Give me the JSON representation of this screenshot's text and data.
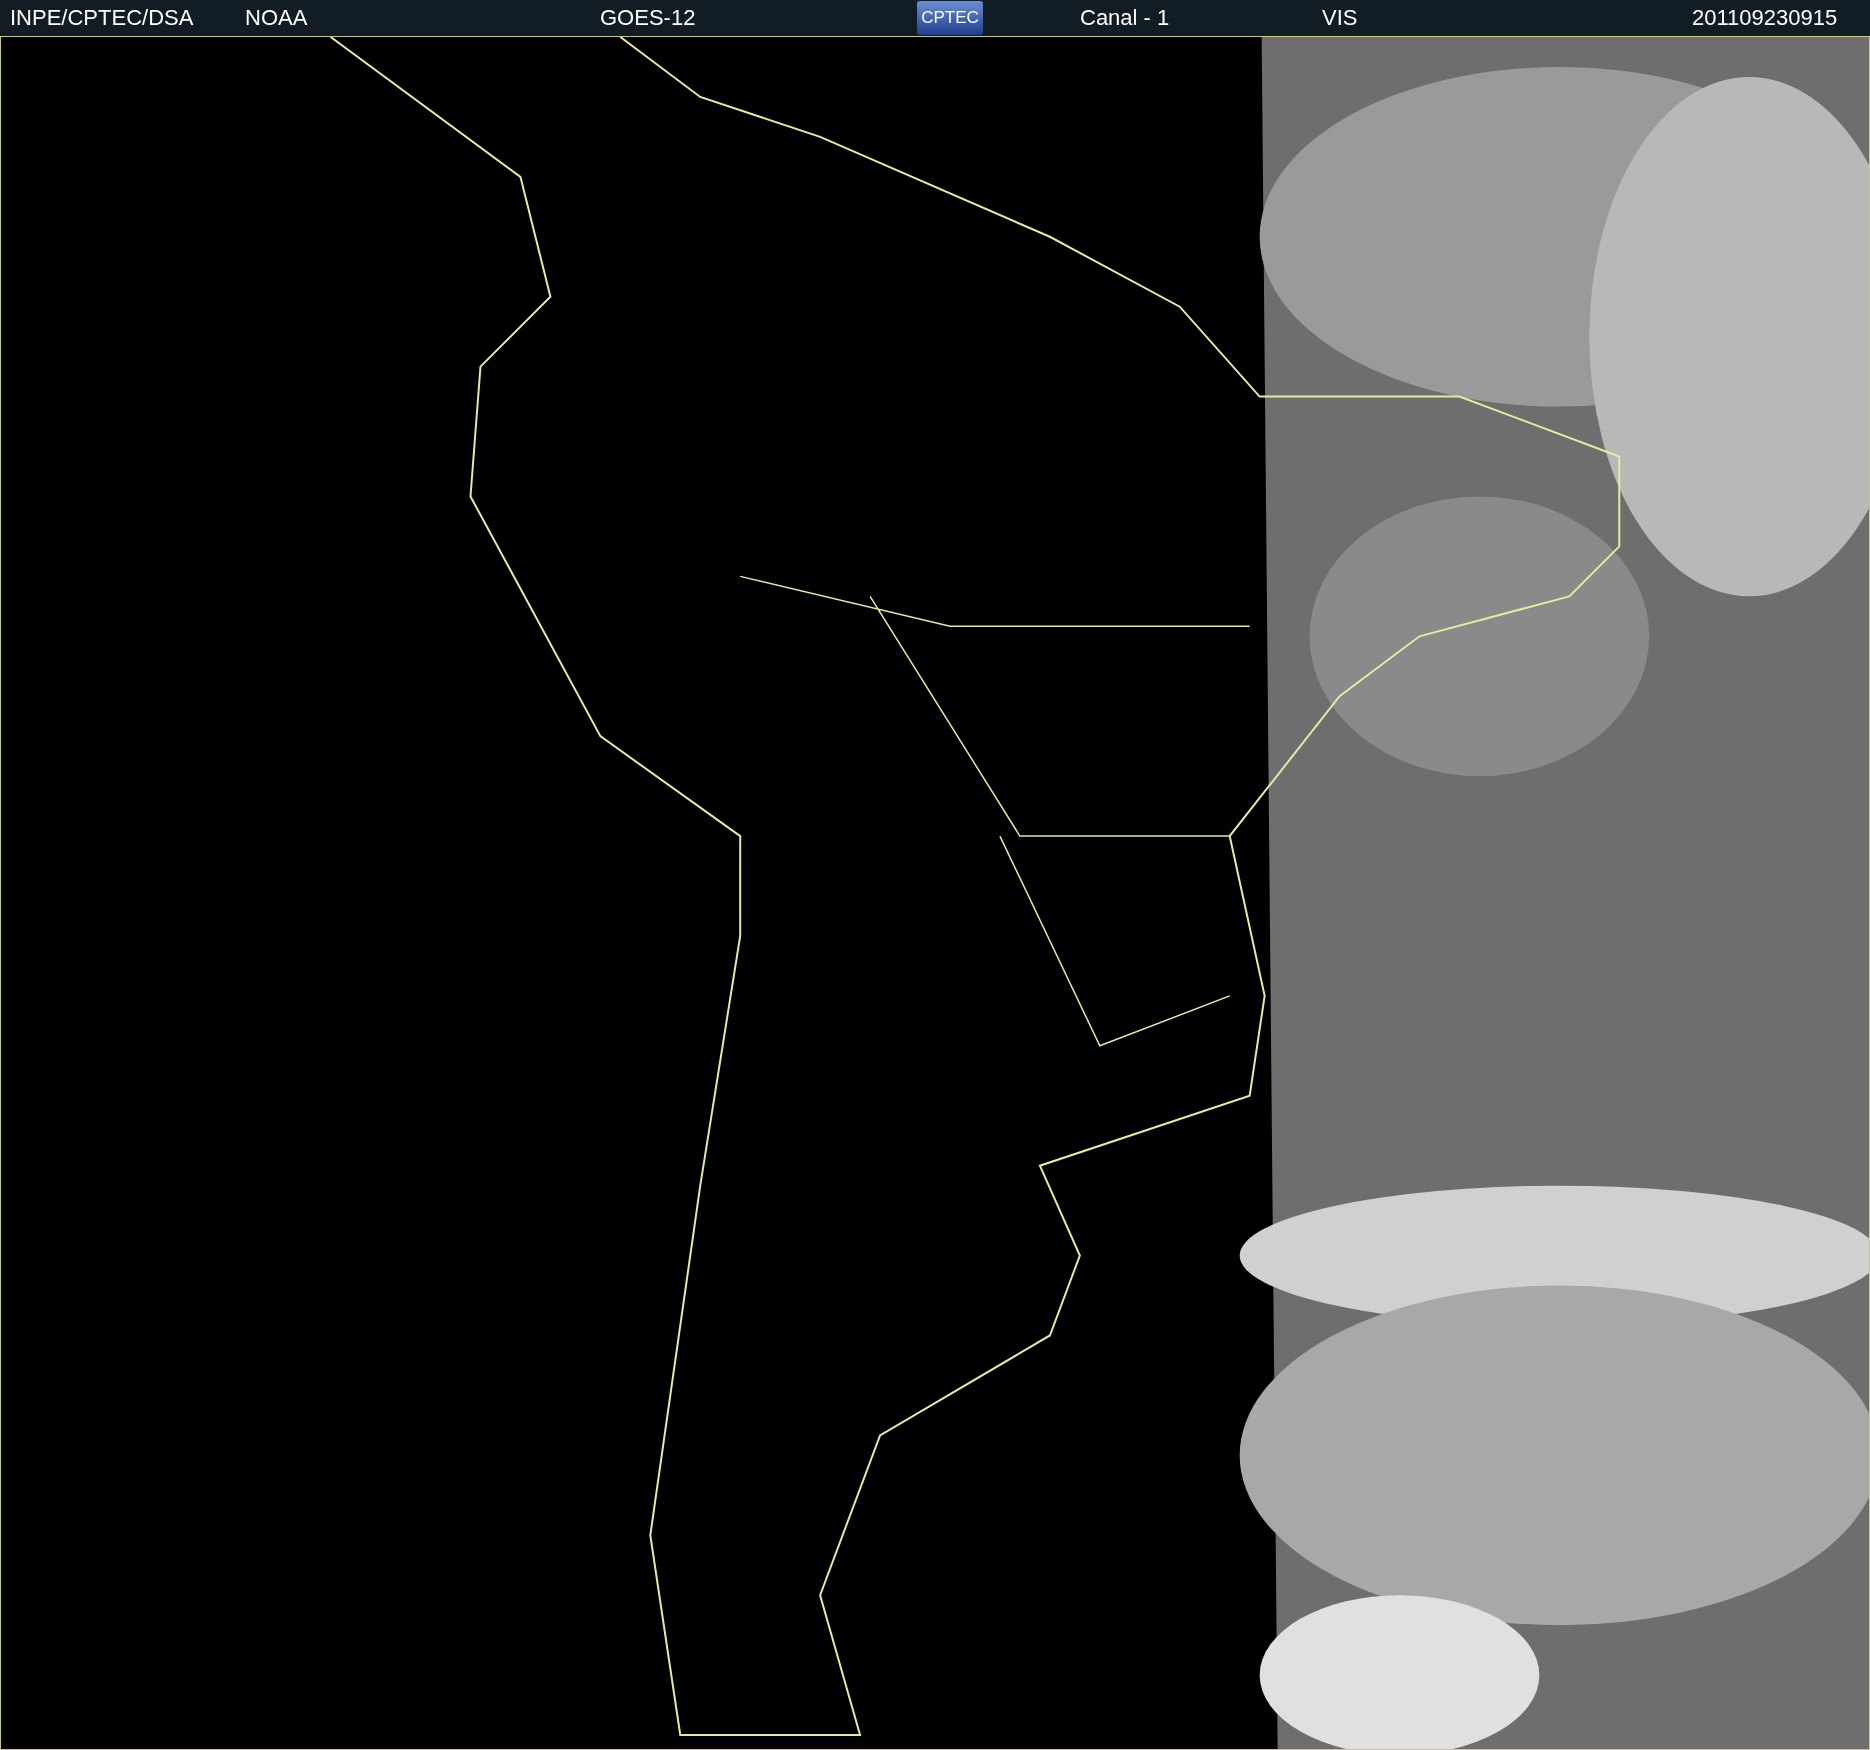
{
  "header": {
    "items": [
      {
        "kind": "text",
        "text": "INPE/CPTEC/DSA"
      },
      {
        "kind": "text",
        "text": "NOAA"
      },
      {
        "kind": "text",
        "text": "GOES-12"
      },
      {
        "kind": "logo",
        "text": "CPTEC"
      },
      {
        "kind": "text",
        "text": "Canal - 1"
      },
      {
        "kind": "text",
        "text": "VIS"
      },
      {
        "kind": "text",
        "text": "201109230915"
      }
    ]
  }
}
